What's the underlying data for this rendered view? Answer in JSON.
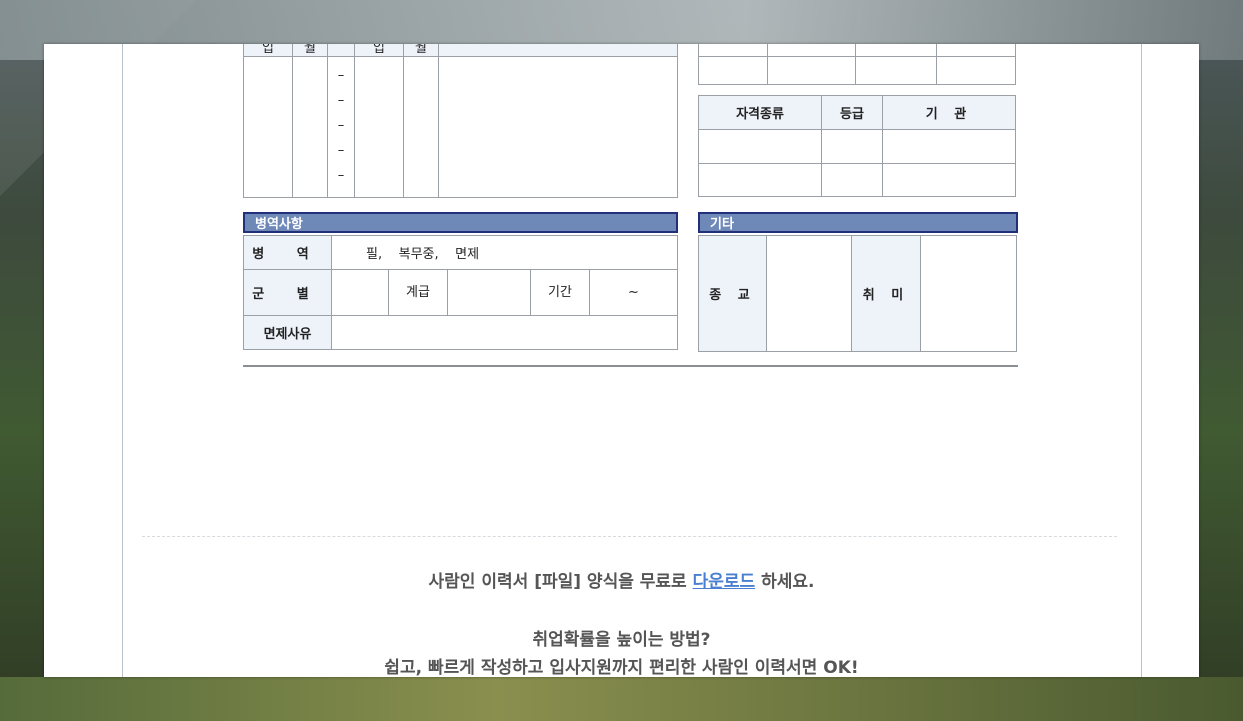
{
  "edu_table": {
    "header_partial": [
      "입",
      "월",
      "",
      "입",
      "월"
    ],
    "dashes": [
      "–",
      "–",
      "–",
      "–",
      "–"
    ]
  },
  "cert_table": {
    "headers": [
      "자격종류",
      "등급",
      "기 관"
    ]
  },
  "military": {
    "title": "병역사항",
    "row1_label": "병 역",
    "row1_value": "필,    복무중,    면제",
    "row2_label": "군 별",
    "rank_label": "계급",
    "period_label": "기간",
    "period_value": "~",
    "row3_label": "면제사유"
  },
  "other": {
    "title": "기타",
    "religion_label": "종 교",
    "hobby_label": "취 미"
  },
  "footer": {
    "line1_pre": "사람인 이력서 [파일] 양식을 무료로 ",
    "line1_link": "다운로드",
    "line1_post": " 하세요.",
    "line2": "취업확률을 높이는 방법?",
    "line3": "쉽고, 빠르게 작성하고 입사지원까지 편리한 사람인 이력서면 OK!"
  },
  "colors": {
    "accent": "#6e88b8",
    "border": "#22307a",
    "link": "#4a7fd0"
  }
}
